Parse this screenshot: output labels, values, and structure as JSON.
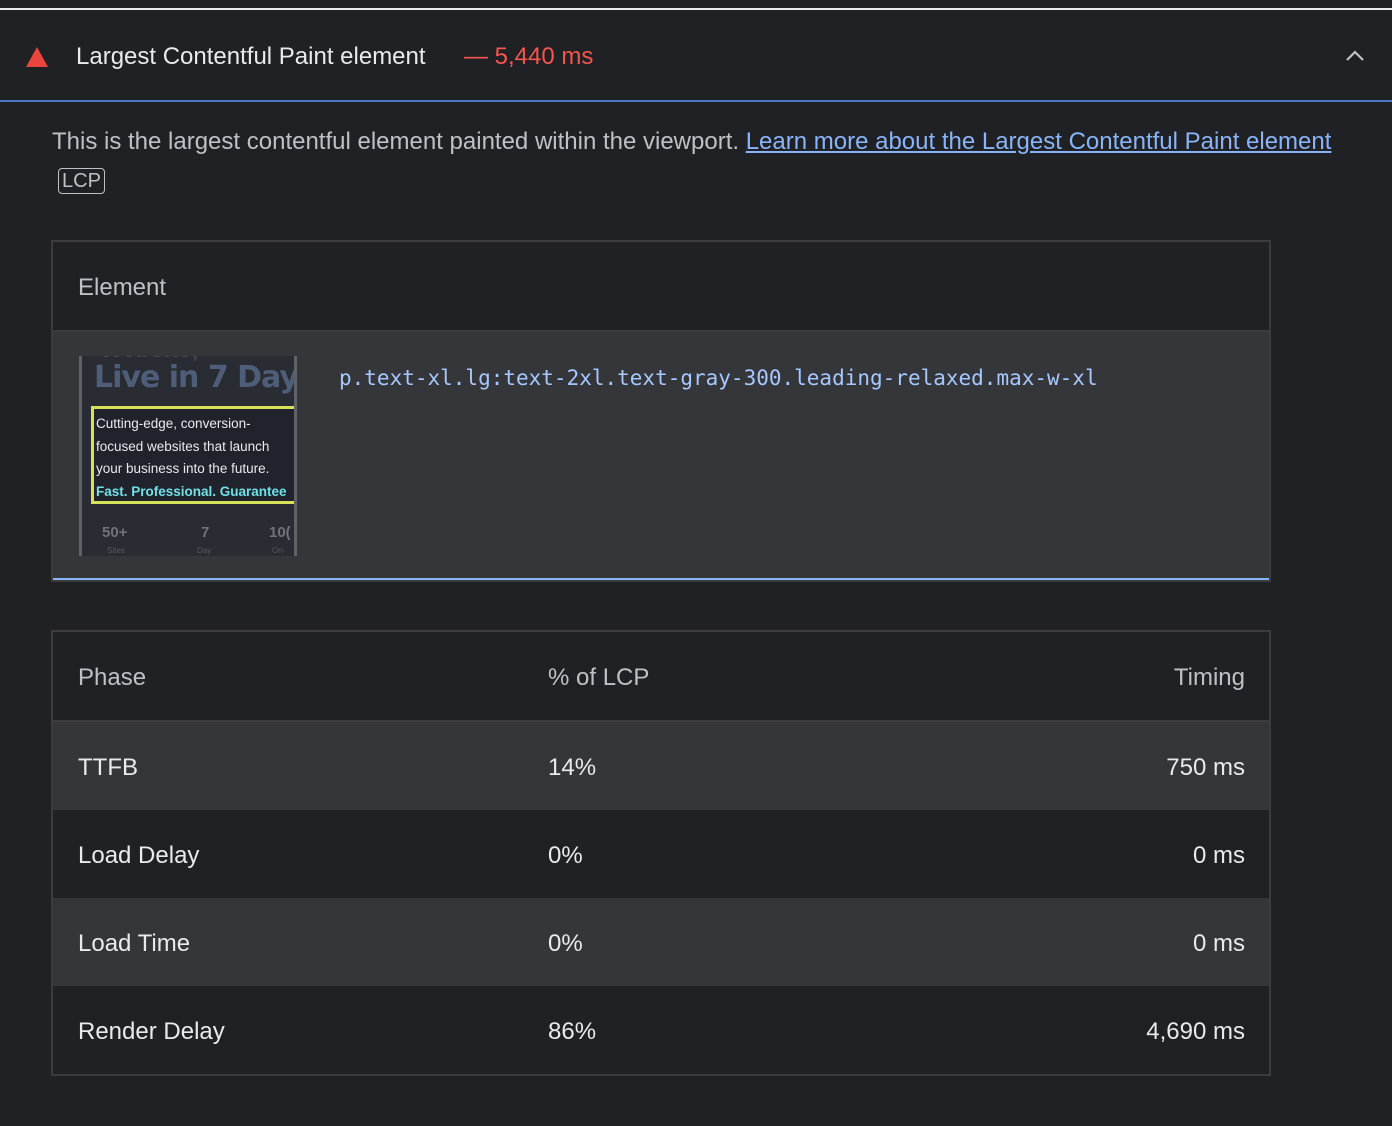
{
  "header": {
    "title": "Largest Contentful Paint element",
    "value": "— 5,440 ms",
    "warning_icon": "warning-triangle-icon",
    "collapse_icon": "chevron-up-icon"
  },
  "description": {
    "text": "This is the largest contentful element painted within the viewport. ",
    "link": "Learn more about the Largest Contentful Paint element",
    "badge": "LCP"
  },
  "element_table": {
    "header": "Element",
    "thumbnail": {
      "heading_top": "Website,",
      "heading": "Live in 7 Day",
      "lines": [
        "Cutting-edge, conversion-",
        "focused websites that launch",
        "your business into the future."
      ],
      "highlight": "Fast. Professional. Guarantee",
      "stats": [
        "50+",
        "7",
        "10("
      ],
      "stat_labels": [
        "Sites",
        "Day",
        "On-"
      ]
    },
    "selector": "p.text-xl.lg:text-2xl.text-gray-300.leading-relaxed.max-w-xl"
  },
  "phase_table": {
    "columns": [
      "Phase",
      "% of LCP",
      "Timing"
    ],
    "rows": [
      {
        "phase": "TTFB",
        "percent": "14%",
        "timing": "750 ms"
      },
      {
        "phase": "Load Delay",
        "percent": "0%",
        "timing": "0 ms"
      },
      {
        "phase": "Load Time",
        "percent": "0%",
        "timing": "0 ms"
      },
      {
        "phase": "Render Delay",
        "percent": "86%",
        "timing": "4,690 ms"
      }
    ]
  },
  "colors": {
    "background": "#202124",
    "warning": "#f4564f",
    "link": "#8ab4f8",
    "row_alt": "#35363a"
  }
}
